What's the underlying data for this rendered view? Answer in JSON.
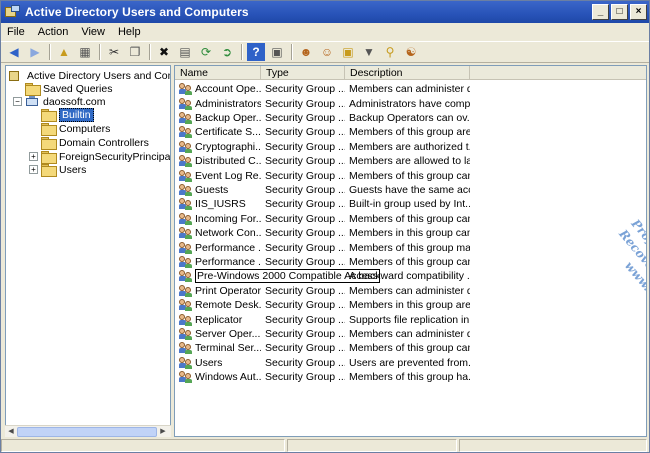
{
  "window": {
    "title": "Active Directory Users and Computers"
  },
  "window_controls": {
    "minimize": "_",
    "maximize": "□",
    "close": "×"
  },
  "menu": [
    "File",
    "Action",
    "View",
    "Help"
  ],
  "tree": {
    "items": [
      {
        "label": "Active Directory Users and Comput"
      },
      {
        "label": "Saved Queries"
      },
      {
        "label": "daossoft.com"
      },
      {
        "label": "Builtin"
      },
      {
        "label": "Computers"
      },
      {
        "label": "Domain Controllers"
      },
      {
        "label": "ForeignSecurityPrincipals"
      },
      {
        "label": "Users"
      }
    ]
  },
  "columns": [
    "Name",
    "Type",
    "Description"
  ],
  "rows": [
    {
      "name": "Account Ope...",
      "type": "Security Group ...",
      "desc": "Members can administer d..."
    },
    {
      "name": "Administrators",
      "type": "Security Group ...",
      "desc": "Administrators have compl..."
    },
    {
      "name": "Backup Oper...",
      "type": "Security Group ...",
      "desc": "Backup Operators can ov..."
    },
    {
      "name": "Certificate S...",
      "type": "Security Group ...",
      "desc": "Members of this group are..."
    },
    {
      "name": "Cryptographi...",
      "type": "Security Group ...",
      "desc": "Members are authorized t..."
    },
    {
      "name": "Distributed C...",
      "type": "Security Group ...",
      "desc": "Members are allowed to la..."
    },
    {
      "name": "Event Log Re...",
      "type": "Security Group ...",
      "desc": "Members of this group can..."
    },
    {
      "name": "Guests",
      "type": "Security Group ...",
      "desc": "Guests have the same acc..."
    },
    {
      "name": "IIS_IUSRS",
      "type": "Security Group ...",
      "desc": "Built-in group used by Int..."
    },
    {
      "name": "Incoming For...",
      "type": "Security Group ...",
      "desc": "Members of this group can..."
    },
    {
      "name": "Network Con...",
      "type": "Security Group ...",
      "desc": "Members in this group can..."
    },
    {
      "name": "Performance ...",
      "type": "Security Group ...",
      "desc": "Members of this group ma..."
    },
    {
      "name": "Performance ...",
      "type": "Security Group ...",
      "desc": "Members of this group can..."
    },
    {
      "name": "Pre-Windows 2000 Compatible Access",
      "type": "",
      "desc": "A backward compatibility ..."
    },
    {
      "name": "Print Operators",
      "type": "Security Group ...",
      "desc": "Members can administer d..."
    },
    {
      "name": "Remote Desk...",
      "type": "Security Group ...",
      "desc": "Members in this group are..."
    },
    {
      "name": "Replicator",
      "type": "Security Group ...",
      "desc": "Supports file replication in..."
    },
    {
      "name": "Server Oper...",
      "type": "Security Group ...",
      "desc": "Members can administer d..."
    },
    {
      "name": "Terminal Ser...",
      "type": "Security Group ...",
      "desc": "Members of this group can..."
    },
    {
      "name": "Users",
      "type": "Security Group ...",
      "desc": "Users are prevented from..."
    },
    {
      "name": "Windows Aut...",
      "type": "Security Group ...",
      "desc": "Members of this group ha..."
    }
  ],
  "watermark": {
    "line1": "Professional Password Recovery",
    "line2": "www.daossoft.com"
  },
  "toolbar": {
    "icons": [
      "back-arrow-icon",
      "forward-arrow-icon",
      "up-folder-icon",
      "show-hide-tree-icon",
      "cut-icon",
      "copy-icon",
      "delete-icon",
      "properties-icon",
      "refresh-icon",
      "export-list-icon",
      "help-icon",
      "console-icon",
      "new-user-icon",
      "new-group-icon",
      "new-ou-icon",
      "filter-icon",
      "find-icon",
      "add-to-group-icon"
    ]
  },
  "colors": {
    "titlebar": "#2853b8",
    "selection": "#316ac5",
    "watermark": "#7aa2d6"
  }
}
